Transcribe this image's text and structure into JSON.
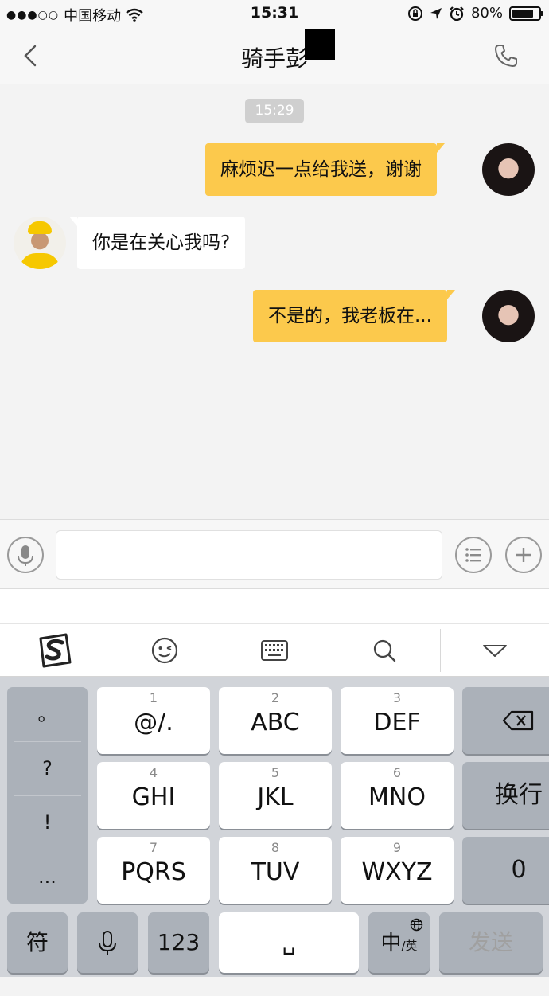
{
  "status_bar": {
    "carrier": "中国移动",
    "time": "15:31",
    "battery": "80%",
    "battery_level": 0.8,
    "icons": [
      "signal-dots",
      "wifi-icon",
      "orientation-lock-icon",
      "location-arrow-icon",
      "alarm-icon",
      "battery-icon"
    ]
  },
  "nav": {
    "title": "骑手彭",
    "icons": [
      "back-chevron-icon",
      "phone-icon"
    ]
  },
  "chat": {
    "timestamp": "15:29",
    "messages": [
      {
        "sender": "me",
        "text": "麻烦迟一点给我送，谢谢"
      },
      {
        "sender": "rider",
        "text": "你是在关心我吗?"
      },
      {
        "sender": "me",
        "text": "不是的，我老板在..."
      }
    ]
  },
  "input_bar": {
    "value": "",
    "placeholder": "",
    "icons": [
      "microphone-icon",
      "list-icon",
      "plus-icon"
    ]
  },
  "keyboard_toolbar": {
    "icons": [
      "sogou-logo-icon",
      "emoji-icon",
      "keyboard-icon",
      "search-icon",
      "collapse-triangle-icon"
    ]
  },
  "keyboard": {
    "side_keys": [
      "。",
      "?",
      "!",
      "..."
    ],
    "keys": [
      {
        "num": "1",
        "label": "@/."
      },
      {
        "num": "2",
        "label": "ABC"
      },
      {
        "num": "3",
        "label": "DEF"
      },
      {
        "num": "4",
        "label": "GHI"
      },
      {
        "num": "5",
        "label": "JKL"
      },
      {
        "num": "6",
        "label": "MNO"
      },
      {
        "num": "7",
        "label": "PQRS"
      },
      {
        "num": "8",
        "label": "TUV"
      },
      {
        "num": "9",
        "label": "WXYZ"
      }
    ],
    "right_keys": {
      "delete_icon": "backspace-icon",
      "newline": "换行",
      "zero": "0"
    },
    "bottom": {
      "symbols": "符",
      "voice_icon": "microphone-icon",
      "numbers": "123",
      "space": "␣",
      "lang_main": "中",
      "lang_sub": "/英",
      "globe_icon": "globe-icon",
      "send": "发送"
    }
  },
  "colors": {
    "my_bubble": "#fcc94c",
    "their_bubble": "#ffffff",
    "chat_background": "#f3f3f3",
    "keyboard_background": "#d1d4d9",
    "send_text": "#a0a0a0"
  }
}
